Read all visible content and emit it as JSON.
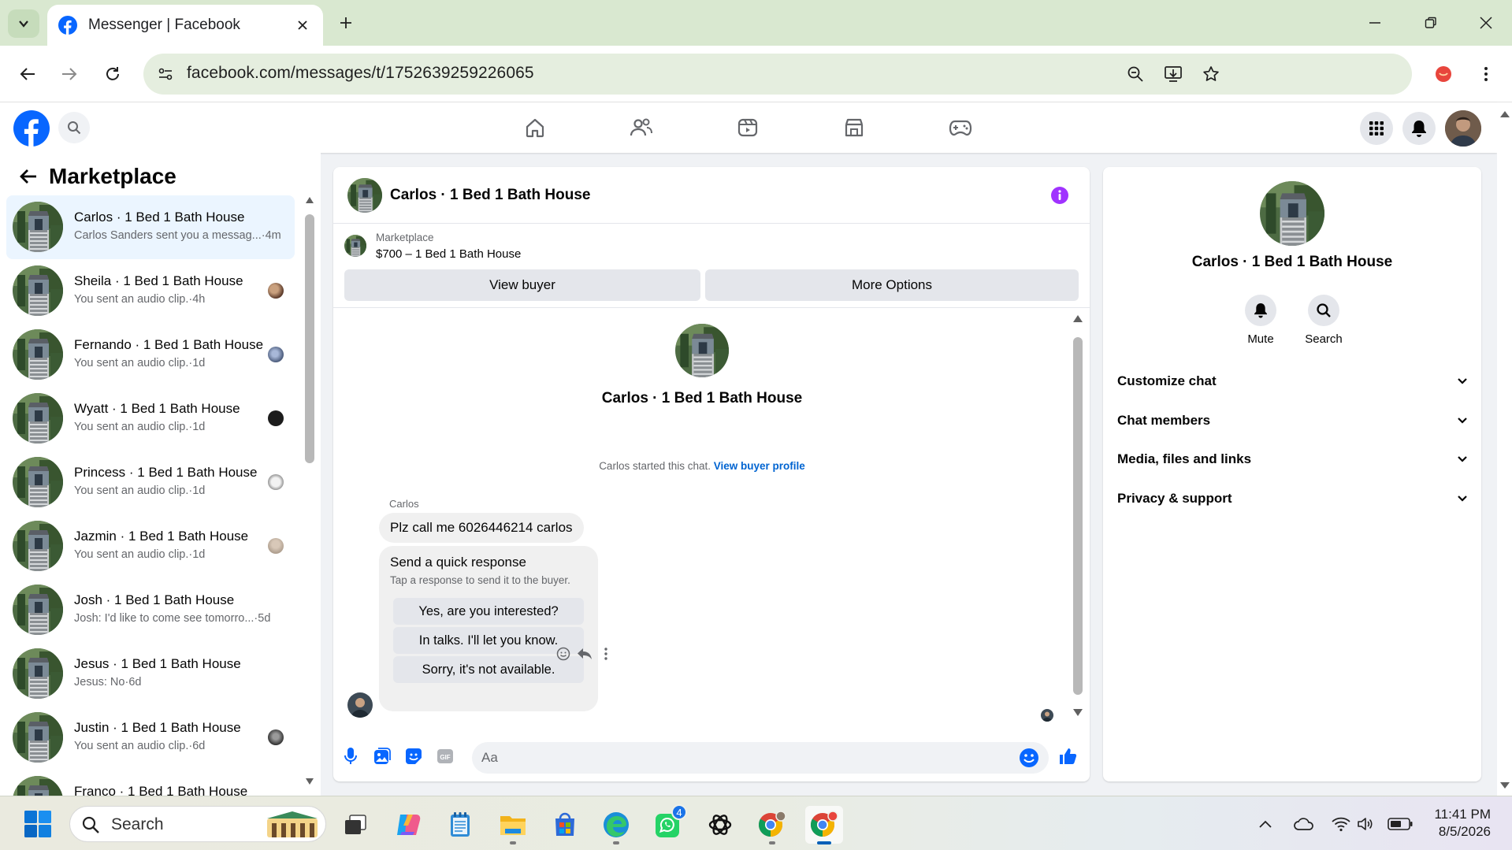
{
  "browser": {
    "tab_title": "Messenger | Facebook",
    "url": "facebook.com/messages/t/1752639259226065"
  },
  "left": {
    "title": "Marketplace",
    "conversations": [
      {
        "name": "Carlos · 1 Bed 1 Bath House",
        "preview": "Carlos Sanders sent you a messag...",
        "time": "·4m",
        "active": true
      },
      {
        "name": "Sheila · 1 Bed 1 Bath House",
        "preview": "You sent an audio clip.",
        "time": "·4h"
      },
      {
        "name": "Fernando · 1 Bed 1 Bath House",
        "preview": "You sent an audio clip.",
        "time": "·1d"
      },
      {
        "name": "Wyatt · 1 Bed 1 Bath House",
        "preview": "You sent an audio clip.",
        "time": "·1d"
      },
      {
        "name": "Princess · 1 Bed 1 Bath House",
        "preview": "You sent an audio clip.",
        "time": "·1d"
      },
      {
        "name": "Jazmin · 1 Bed 1 Bath House",
        "preview": "You sent an audio clip.",
        "time": "·1d"
      },
      {
        "name": "Josh · 1 Bed 1 Bath House",
        "preview": "Josh: I'd like to come see tomorro...",
        "time": "·5d"
      },
      {
        "name": "Jesus · 1 Bed 1 Bath House",
        "preview": "Jesus: No",
        "time": "·6d"
      },
      {
        "name": "Justin · 1 Bed 1 Bath House",
        "preview": "You sent an audio clip.",
        "time": "·6d"
      },
      {
        "name": "Franco · 1 Bed 1 Bath House",
        "preview": "",
        "time": ""
      }
    ]
  },
  "chat": {
    "title": "Carlos · 1 Bed 1 Bath House",
    "marketplace_label": "Marketplace",
    "listing": "$700 – 1 Bed 1 Bath House",
    "view_buyer": "View buyer",
    "more_options": "More Options",
    "center_name": "Carlos · 1 Bed 1 Bath House",
    "started_text": "Carlos started this chat.",
    "view_buyer_profile": "View buyer profile",
    "sender": "Carlos",
    "message": "Plz call me 6026446214 carlos",
    "quick_title": "Send a quick response",
    "quick_sub": "Tap a response to send it to the buyer.",
    "quick_responses": [
      "Yes, are you interested?",
      "In talks. I'll let you know.",
      "Sorry, it's not available."
    ],
    "composer_placeholder": "Aa"
  },
  "right": {
    "name": "Carlos · 1 Bed 1 Bath House",
    "mute": "Mute",
    "search": "Search",
    "sections": [
      "Customize chat",
      "Chat members",
      "Media, files and links",
      "Privacy & support"
    ]
  },
  "taskbar": {
    "search": "Search",
    "time": "11:41 PM",
    "date": "8/5/2026",
    "whatsapp_badge": "4"
  },
  "colors": {
    "fb_blue": "#0866ff",
    "messenger_purple": "#a033ff",
    "link_blue": "#0064d1",
    "active_row": "#ebf5ff"
  }
}
